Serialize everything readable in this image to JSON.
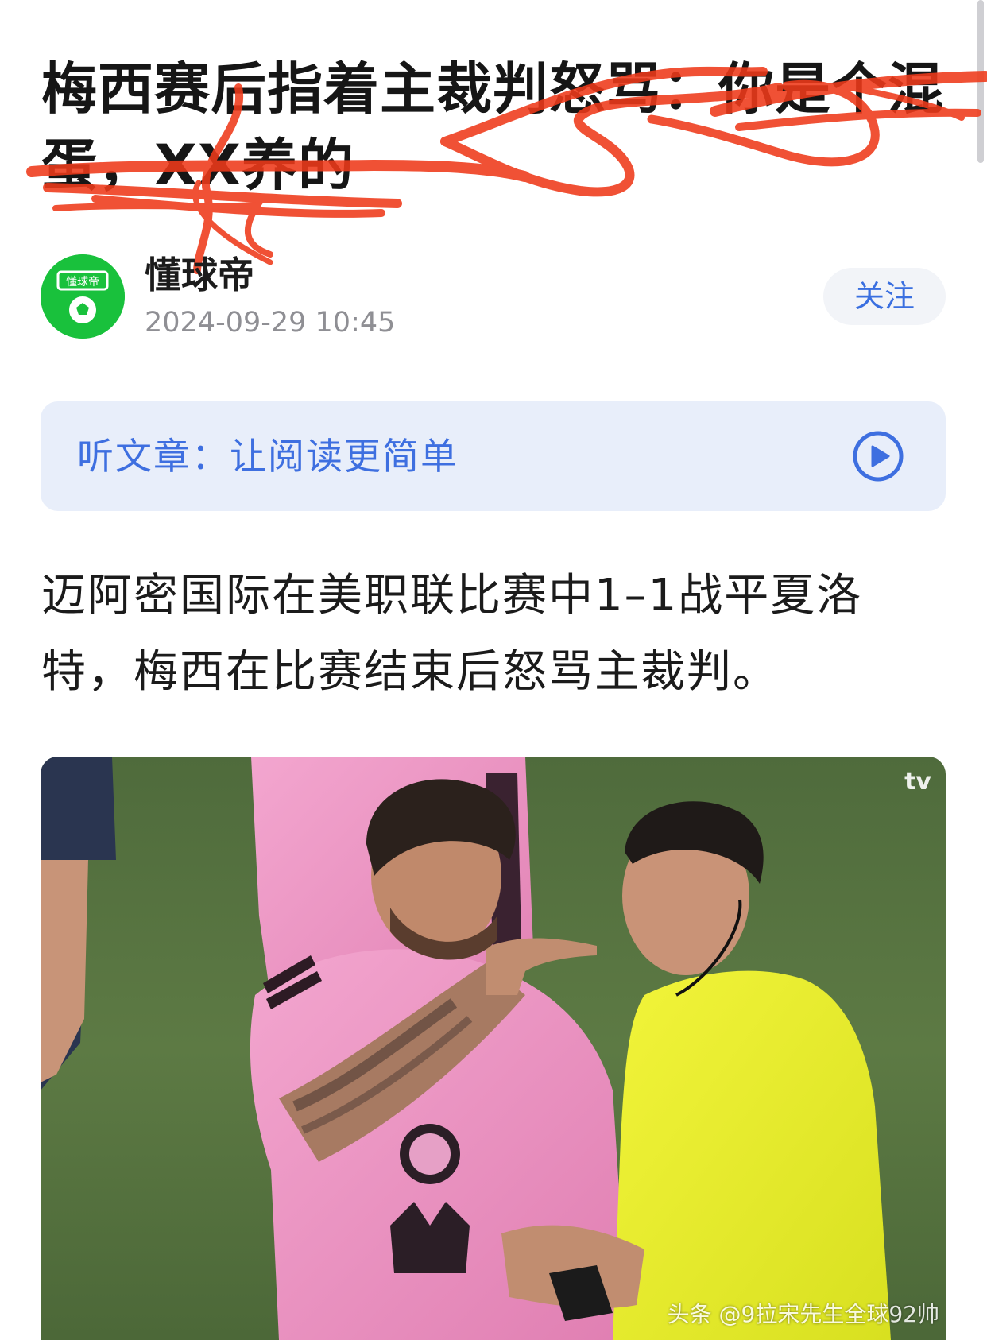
{
  "article": {
    "title": "梅西赛后指着主裁判怒骂：你是个混蛋，XX养的",
    "paragraph": "迈阿密国际在美职联比赛中1–1战平夏洛特，梅西在比赛结束后怒骂主裁判。"
  },
  "author": {
    "name": "懂球帝",
    "timestamp": "2024-09-29 10:45",
    "avatar_label": "懂球帝",
    "avatar_color": "#19c13c"
  },
  "follow": {
    "label": "关注"
  },
  "listen": {
    "label": "听文章：让阅读更简单",
    "icon": "play-icon"
  },
  "photo": {
    "broadcaster_logo": "tv",
    "watermark": "头条 @9拉宋先生全球92帅"
  },
  "colors": {
    "accent": "#3e6fe0",
    "scribble": "#ef3a1a",
    "title": "#161616"
  }
}
